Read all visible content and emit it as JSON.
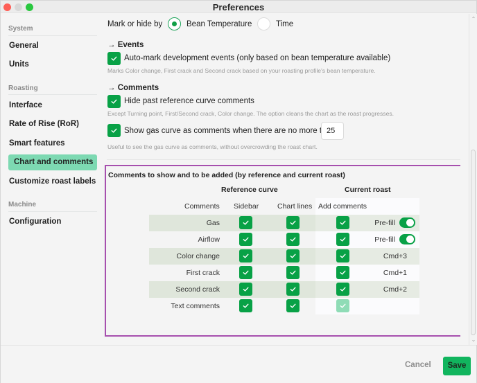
{
  "window": {
    "title": "Preferences"
  },
  "sidebar": {
    "sections": [
      {
        "label": "System",
        "items": [
          {
            "label": "General"
          },
          {
            "label": "Units"
          }
        ]
      },
      {
        "label": "Roasting",
        "items": [
          {
            "label": "Interface"
          },
          {
            "label": "Rate of Rise (RoR)"
          },
          {
            "label": "Smart features"
          },
          {
            "label": "Chart and comments",
            "active": true
          },
          {
            "label": "Customize roast labels"
          }
        ]
      },
      {
        "label": "Machine",
        "items": [
          {
            "label": "Configuration"
          }
        ]
      }
    ]
  },
  "main": {
    "mark_or_hide": {
      "label": "Mark or hide by",
      "options": [
        {
          "label": "Bean Temperature",
          "selected": true
        },
        {
          "label": "Time",
          "selected": false
        }
      ]
    },
    "events": {
      "heading": "→ Events",
      "auto_mark": {
        "label": "Auto-mark development events (only based on bean temperature available)",
        "checked": true,
        "hint": "Marks Color change, First crack and Second crack based on your roasting profile's bean temperature."
      }
    },
    "comments": {
      "heading": "→ Comments",
      "hide_past": {
        "label": "Hide past reference curve comments",
        "checked": true,
        "hint": "Except Turning point, First/Second crack, Color change. The option cleans the chart as the roast progresses."
      },
      "gas_curve": {
        "label": "Show gas curve as comments when there are no more than",
        "checked": true,
        "value": "25",
        "hint": "Useful to see the gas curve as comments, without overcrowding the roast chart."
      }
    },
    "comments_table": {
      "title": "Comments to show and to be added (by reference and current roast)",
      "group_headers": {
        "reference": "Reference curve",
        "current": "Current roast"
      },
      "columns": {
        "comments": "Comments",
        "sidebar": "Sidebar",
        "chart_lines": "Chart lines",
        "add_comments": "Add comments"
      },
      "rows": [
        {
          "label": "Gas",
          "sidebar": true,
          "chart_lines": true,
          "add": true,
          "extra_type": "toggle",
          "extra_label": "Pre-fill",
          "toggle_on": true
        },
        {
          "label": "Airflow",
          "sidebar": true,
          "chart_lines": true,
          "add": true,
          "extra_type": "toggle",
          "extra_label": "Pre-fill",
          "toggle_on": true
        },
        {
          "label": "Color change",
          "sidebar": true,
          "chart_lines": true,
          "add": true,
          "extra_type": "shortcut",
          "extra_label": "Cmd+3"
        },
        {
          "label": "First crack",
          "sidebar": true,
          "chart_lines": true,
          "add": true,
          "extra_type": "shortcut",
          "extra_label": "Cmd+1"
        },
        {
          "label": "Second crack",
          "sidebar": true,
          "chart_lines": true,
          "add": true,
          "extra_type": "shortcut",
          "extra_label": "Cmd+2"
        },
        {
          "label": "Text comments",
          "sidebar": true,
          "chart_lines": true,
          "add": true,
          "add_disabled": true,
          "extra_type": "none",
          "extra_label": ""
        }
      ]
    }
  },
  "footer": {
    "cancel_label": "Cancel",
    "save_label": "Save"
  },
  "colors": {
    "accent_green": "#08a146",
    "active_nav": "#7dd9b2",
    "highlight_border": "#a64fae",
    "save_button": "#11b55e"
  }
}
